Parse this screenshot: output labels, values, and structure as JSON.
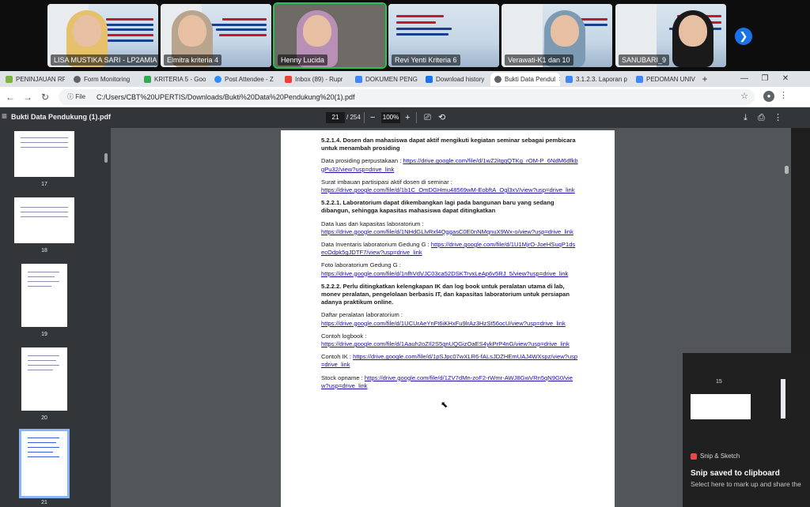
{
  "meeting": {
    "participants": [
      {
        "name": "LISA MUSTIKA SARI - LP2AMIA"
      },
      {
        "name": "Elmitra kriteria 4"
      },
      {
        "name": "Henny Lucida"
      },
      {
        "name": "Revi Yenti Kriteria 6"
      },
      {
        "name": "Verawati-K1 dan 10"
      },
      {
        "name": "SANUBARI_9"
      }
    ],
    "next_icon": "chevron-right-icon"
  },
  "browser": {
    "tabs": [
      {
        "label": "PENINJAUAN RPS"
      },
      {
        "label": "Form Monitoring"
      },
      {
        "label": "KRITERIA 5 - Goo"
      },
      {
        "label": "Post Attendee - Z"
      },
      {
        "label": "Inbox (89) - Rupr"
      },
      {
        "label": "DOKUMEN PENG"
      },
      {
        "label": "Download history"
      },
      {
        "label": "Bukti Data Pendul"
      },
      {
        "label": "3.1.2.3. Laporan p"
      },
      {
        "label": "PEDOMAN UNIV"
      }
    ],
    "new_tab": "+",
    "address_chip": "File",
    "url": "C:/Users/CBT%20UPERTIS/Downloads/Bukti%20Data%20Pendukung%20(1).pdf"
  },
  "pdf": {
    "title": "Bukti Data Pendukung (1).pdf",
    "current_page": "21",
    "page_total": "/ 254",
    "zoom": "100%",
    "zoom_out": "−",
    "zoom_in": "+",
    "thumbnails": [
      {
        "label": "17"
      },
      {
        "label": "18"
      },
      {
        "label": "19"
      },
      {
        "label": "20"
      },
      {
        "label": "21"
      }
    ],
    "content": {
      "h1": "5.2.1.4. Dosen dan mahasiswa dapat aktif mengikuti kegiatan seminar sebagai pembicara untuk menambah prosiding",
      "p1_label": "Data prosiding perpustakaan : ",
      "p1_link": "https://drive.google.com/file/d/1wZ2itgqQTKg_rOM-P_6NdM6dfkbgPu32/view?usp=drive_link",
      "p2_label": "Surat imbauan partisipasi aktif dosen di seminar :",
      "p2_link": "https://drive.google.com/file/d/1b1C_OmDGHmu48569wM-EobftA_Ogl3xV/view?usp=drive_link",
      "h2": "5.2.2.1. Laboratorium dapat dikembangkan lagi pada bangunan baru yang sedang dibangun, sehingga kapasitas mahasiswa dapat ditingkatkan",
      "p3_label": "Data luas dan kapasitas laboratorium :",
      "p3_link": "https://drive.google.com/file/d/1NHdGLlvRxf4QggasC0E0nNMqnuX9Wx-o/view?usp=drive_link",
      "p4_label": "Data Inventaris laboratorium Gedung G : ",
      "p4_link": "https://drive.google.com/file/d/1U1MjrO-JoeHSuqP1dsecOdpk5gJDTF7/view?usp=drive_link",
      "p5_label": "Foto laboratorium Gedung G :",
      "p5_link": "https://drive.google.com/file/d/1nfhVdVJC03ca52DSKTrvxLeAp6v5RJ_5/view?usp=drive_link",
      "h3": "5.2.2.2. Perlu ditingkatkan kelengkapan IK dan log book untuk peralatan utama di lab, monev peralatan, pengelolaan berbasis IT, dan kapasitas laboratorium untuk persiapan adanya praktikum online.",
      "p6_label": "Daftar peralatan laboratorium :",
      "p6_link": "https://drive.google.com/file/d/1UCUrAeYnFt6iKHxFu9lrAz3HzSt56ocU/view?usp=drive_link",
      "p7_label": "Contoh logbook :",
      "p7_link": "https://drive.google.com/file/d/1Aauh2oZIl2S5gnUQGizOaES4ykPrP4nG/view?usp=drive_link",
      "p8_label": "Contoh IK : ",
      "p8_link": "https://drive.google.com/file/d/1pSJpc07wXLR6-fALsJDZHEmUAJ4WXspz/view?usp=drive_link",
      "p9_label": "Stock opname : ",
      "p9_link": "https://drive.google.com/file/d/1ZV7dMn-zoF2-rWmr-AWJ8GwVRn5qN9G0/view?usp=drive_link"
    }
  },
  "notification": {
    "page_label": "15",
    "app": "Snip & Sketch",
    "title": "Snip saved to clipboard",
    "body": "Select here to mark up and share the"
  }
}
